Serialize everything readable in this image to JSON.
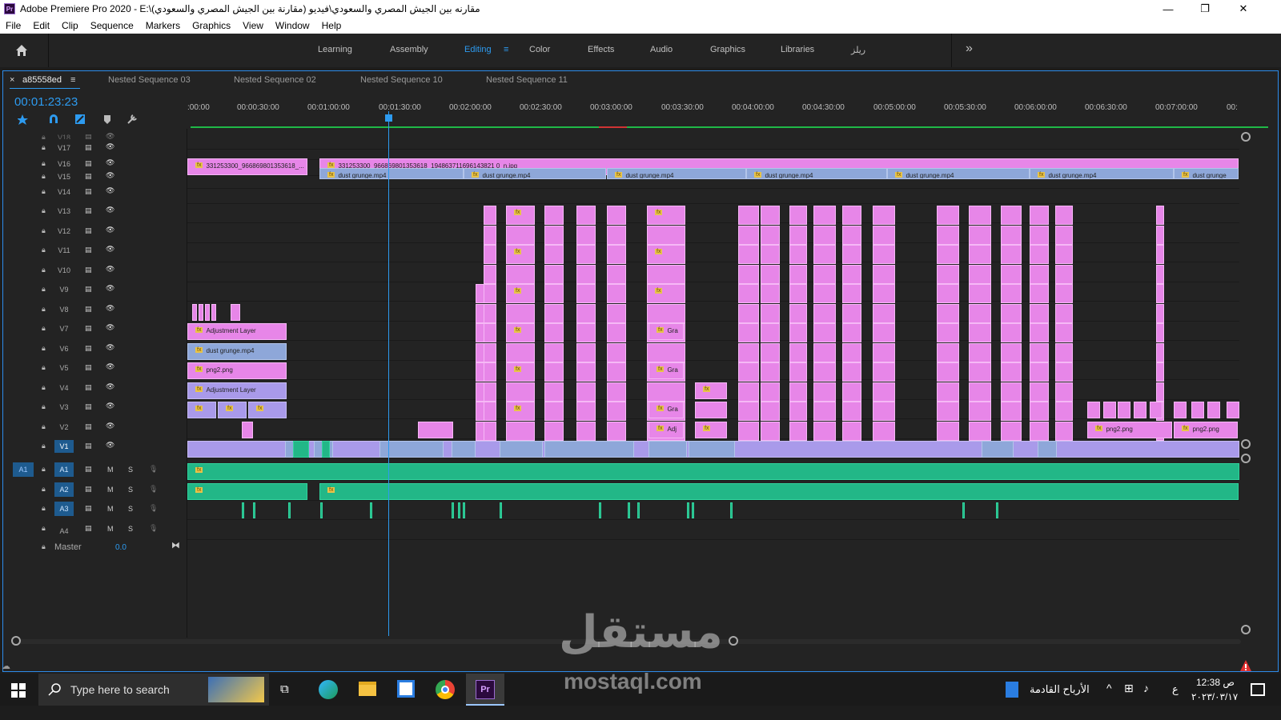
{
  "window": {
    "title": "Adobe Premiere Pro 2020 - E:\\مقارنه بين الجيش المصري والسعودي\\فيديو (مقارنة بين الجيش المصري والسعودي)",
    "app_icon": "Pr",
    "minimize": "—",
    "maximize": "❐",
    "close": "✕"
  },
  "menu": [
    "File",
    "Edit",
    "Clip",
    "Sequence",
    "Markers",
    "Graphics",
    "View",
    "Window",
    "Help"
  ],
  "workspaces": {
    "tabs": [
      "Learning",
      "Assembly",
      "Editing",
      "Color",
      "Effects",
      "Audio",
      "Graphics",
      "Libraries",
      "ريلز"
    ],
    "active": "Editing",
    "more": "»"
  },
  "sequence_tabs": {
    "close": "×",
    "active": "a85558ed",
    "others": [
      "Nested Sequence 03",
      "Nested Sequence 02",
      "Nested Sequence 10",
      "Nested Sequence 11"
    ]
  },
  "timeline": {
    "timecode": "00:01:23:23",
    "ruler_labels": [
      ":00:00",
      "00:00:30:00",
      "00:01:00:00",
      "00:01:30:00",
      "00:02:00:00",
      "00:02:30:00",
      "00:03:00:00",
      "00:03:30:00",
      "00:04:00:00",
      "00:04:30:00",
      "00:05:00:00",
      "00:05:30:00",
      "00:06:00:00",
      "00:06:30:00",
      "00:07:00:00",
      "00:"
    ],
    "playhead_seconds": 84,
    "video_tracks": [
      "V18",
      "V17",
      "V16",
      "V15",
      "V14",
      "V13",
      "V12",
      "V11",
      "V10",
      "V9",
      "V8",
      "V7",
      "V6",
      "V5",
      "V4",
      "V3",
      "V2",
      "V1"
    ],
    "audio_tracks": [
      "A1",
      "A2",
      "A3",
      "A4"
    ],
    "source_patch_label": "A1",
    "mute_label": "M",
    "solo_label": "S",
    "master": {
      "label": "Master",
      "value": "0.0"
    },
    "fx": "fx",
    "clips": {
      "image_v16_a": "331253300_966869801353618_...",
      "image_v16_b": "331253300_966869801353618_194863711696143821 0_n.jpg",
      "dust": "dust grunge.mp4",
      "dust_short": "dust grunge",
      "adjustment": "Adjustment Layer",
      "png": "png2.png",
      "gra": "Gra",
      "adj": "Adj"
    },
    "colors": {
      "pink": "#e786e8",
      "blue": "#8ea7d9",
      "purple": "#a99aea",
      "audio_green": "#22b787",
      "timecode_blue": "#2d9bf0",
      "panel_border": "#2d8ceb"
    }
  },
  "taskbar": {
    "search_placeholder": "Type here to search",
    "news": "الأرباح القادمة",
    "lang": "ع",
    "time": "12:38 ص",
    "date": "٢٠٢٣/٠٣/١٧"
  },
  "watermark": {
    "arabic": "مستقل",
    "latin": "mostaql.com"
  }
}
